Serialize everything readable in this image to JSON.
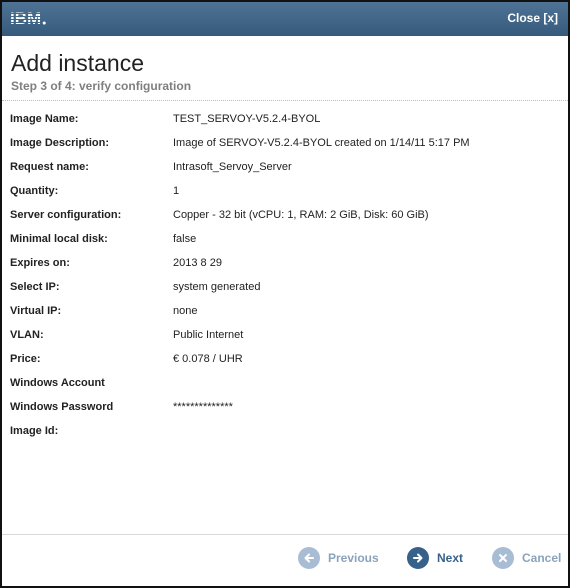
{
  "window": {
    "logo_text": "IBM",
    "close_label": "Close [x]"
  },
  "header": {
    "title": "Add instance",
    "subtitle": "Step 3 of 4: verify configuration"
  },
  "details": [
    {
      "label": "Image Name:",
      "value": "TEST_SERVOY-V5.2.4-BYOL"
    },
    {
      "label": "Image Description:",
      "value": "Image of SERVOY-V5.2.4-BYOL created on 1/14/11 5:17 PM"
    },
    {
      "label": "Request name:",
      "value": "Intrasoft_Servoy_Server"
    },
    {
      "label": "Quantity:",
      "value": "1"
    },
    {
      "label": "Server configuration:",
      "value": "Copper - 32 bit (vCPU: 1, RAM: 2 GiB, Disk: 60 GiB)"
    },
    {
      "label": "Minimal local disk:",
      "value": "false"
    },
    {
      "label": "Expires on:",
      "value": "2013 8 29"
    },
    {
      "label": "Select IP:",
      "value": "system generated"
    },
    {
      "label": "Virtual IP:",
      "value": "none"
    },
    {
      "label": "VLAN:",
      "value": "Public Internet"
    },
    {
      "label": "Price:",
      "value": "€ 0.078 / UHR"
    },
    {
      "label": "Windows Account",
      "value": ""
    },
    {
      "label": "Windows Password",
      "value": "**************"
    },
    {
      "label": "Image Id:",
      "value": ""
    }
  ],
  "footer": {
    "previous_label": "Previous",
    "next_label": "Next",
    "cancel_label": "Cancel"
  },
  "icons": {
    "previous": "arrow-left-icon",
    "next": "arrow-right-icon",
    "cancel": "x-icon"
  },
  "colors": {
    "titlebar": "#3f6587",
    "primary_button": "#36618a",
    "disabled_button": "#a8bdd3"
  }
}
